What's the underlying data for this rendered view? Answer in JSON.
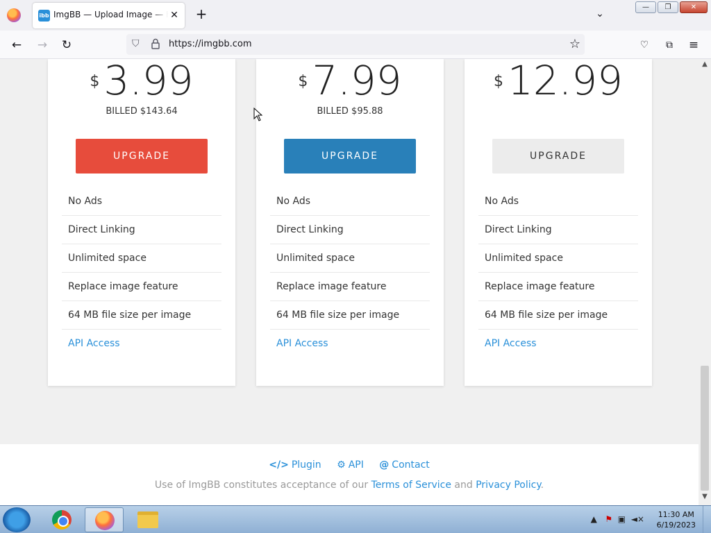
{
  "browser": {
    "tab_title": "ImgBB — Upload Image — Free Image Hosting",
    "tab_icon_text": "ibb",
    "url": "https://imgbb.com",
    "tab_close": "✕",
    "new_tab": "+"
  },
  "plans": [
    {
      "currency": "$",
      "amount": "3.99",
      "billed": "BILLED $143.64",
      "button": "UPGRADE",
      "button_color": "#e74c3c",
      "features": [
        "No Ads",
        "Direct Linking",
        "Unlimited space",
        "Replace image feature",
        "64 MB file size per image"
      ],
      "api": "API Access"
    },
    {
      "currency": "$",
      "amount": "7.99",
      "billed": "BILLED $95.88",
      "button": "UPGRADE",
      "button_color": "#2980b9",
      "features": [
        "No Ads",
        "Direct Linking",
        "Unlimited space",
        "Replace image feature",
        "64 MB file size per image"
      ],
      "api": "API Access"
    },
    {
      "currency": "$",
      "amount": "12.99",
      "billed": "",
      "button": "UPGRADE",
      "button_color": "#ececec",
      "features": [
        "No Ads",
        "Direct Linking",
        "Unlimited space",
        "Replace image feature",
        "64 MB file size per image"
      ],
      "api": "API Access"
    }
  ],
  "footer": {
    "links": [
      {
        "icon": "</>",
        "label": "Plugin"
      },
      {
        "icon": "⚙",
        "label": "API"
      },
      {
        "icon": "@",
        "label": "Contact"
      }
    ],
    "legal_prefix": "Use of ImgBB constitutes acceptance of our",
    "terms": "Terms of Service",
    "and": "and",
    "privacy": "Privacy Policy",
    "legal_suffix": "."
  },
  "taskbar": {
    "time": "11:30 AM",
    "date": "6/19/2023"
  }
}
